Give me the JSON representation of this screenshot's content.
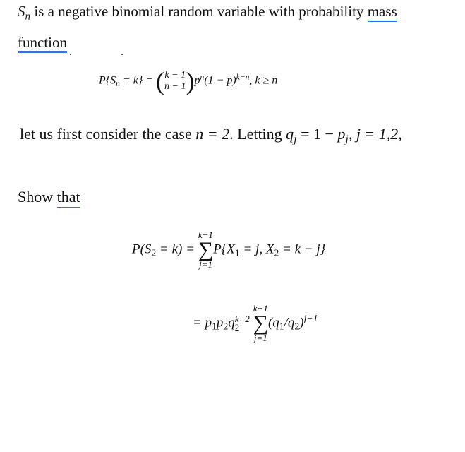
{
  "intro": {
    "variable": "S",
    "variable_sub": "n",
    "text": " is a negative binomial random variable with probability ",
    "underlined_1": "mass",
    "underlined_2": "function"
  },
  "pmf_formula": {
    "lhs": "P{S",
    "lhs_sub": "n",
    "lhs_end": " = k} = ",
    "binom_top": "k − 1",
    "binom_bottom": "n − 1",
    "p": "p",
    "p_exp": "n",
    "middle": "(1 − p)",
    "middle_exp": "k−n",
    "condition": ",   k ≥ n"
  },
  "case_line": {
    "text": "let us first consider the case ",
    "n_eq": "n = 2",
    "letting": ". Letting ",
    "q": "q",
    "q_sub": "j",
    "eq": " = 1 − ",
    "p": "p",
    "p_sub": "j",
    "tail": ", j = 1,2,"
  },
  "show_that": {
    "word1": "Show",
    "word2": "that"
  },
  "eq1": {
    "lhs": "P(S",
    "lhs_sub": "2",
    "lhs_end": " = k) = ",
    "sum_upper": "k−1",
    "sum_symbol": "∑",
    "sum_lower": "j=1",
    "rhs": "P{X",
    "rhs_sub1": "1",
    "rhs_mid": " = j, X",
    "rhs_sub2": "2",
    "rhs_end": " = k − j}"
  },
  "eq2": {
    "lhs": "= p",
    "sub1": "1",
    "p2": "p",
    "sub2": "2",
    "q": "q",
    "q_sub": "2",
    "q_exp": "k−2",
    "sum_upper": "k−1",
    "sum_symbol": "∑",
    "sum_lower": "j=1",
    "rhs": "(q",
    "rhs_sub1": "1",
    "rhs_mid": "/q",
    "rhs_sub2": "2",
    "rhs_end": ")",
    "rhs_exp": "j−1"
  }
}
